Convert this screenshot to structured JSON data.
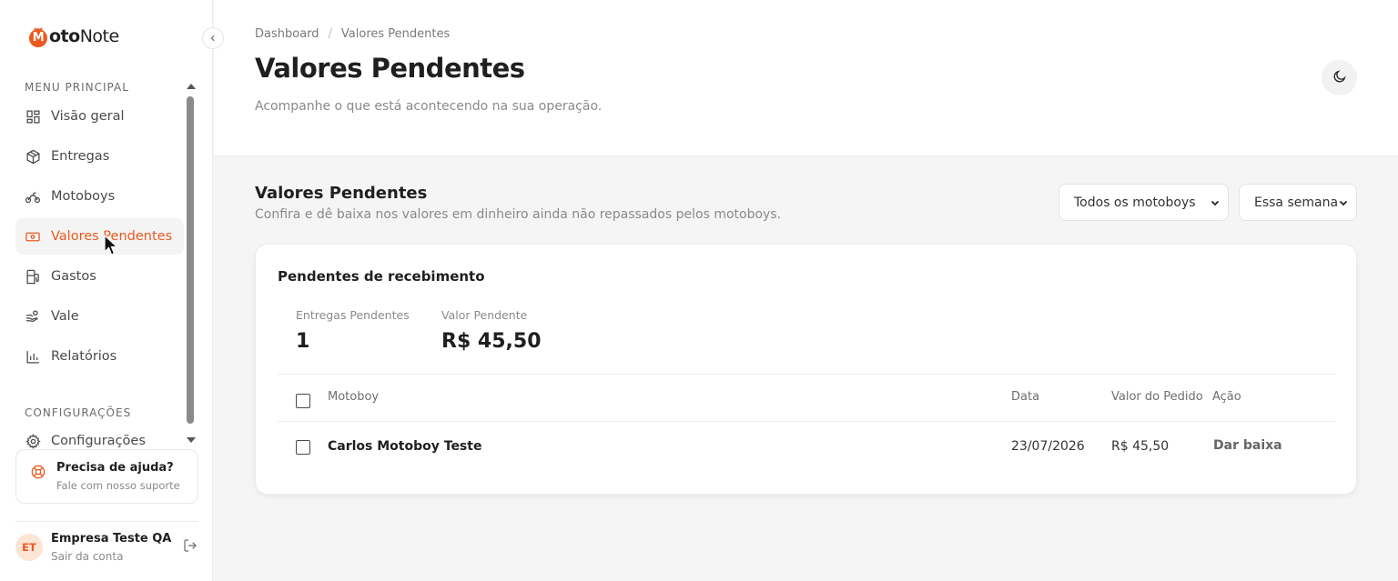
{
  "brand": {
    "logo_letter": "M",
    "logo_bold": "oto",
    "logo_rest": "Note"
  },
  "sidebar": {
    "menu_label": "MENU PRINCIPAL",
    "items": [
      {
        "label": "Visão geral",
        "icon": "dashboard-icon"
      },
      {
        "label": "Entregas",
        "icon": "package-icon"
      },
      {
        "label": "Motoboys",
        "icon": "bike-icon"
      },
      {
        "label": "Valores Pendentes",
        "icon": "banknote-icon",
        "active": true
      },
      {
        "label": "Gastos",
        "icon": "fuel-icon"
      },
      {
        "label": "Vale",
        "icon": "hand-coins-icon"
      },
      {
        "label": "Relatórios",
        "icon": "bar-chart-icon"
      }
    ],
    "config_label": "CONFIGURAÇÕES",
    "config_items": [
      {
        "label": "Configurações",
        "icon": "gear-icon"
      }
    ],
    "help": {
      "title": "Precisa de ajuda?",
      "subtitle": "Fale com nosso suporte"
    },
    "user": {
      "initials": "ET",
      "name": "Empresa Teste QA",
      "action": "Sair da conta"
    }
  },
  "header": {
    "breadcrumb": [
      "Dashboard",
      "Valores Pendentes"
    ],
    "breadcrumb_sep": "/",
    "title": "Valores Pendentes",
    "subtitle": "Acompanhe o que está acontecendo na sua operação."
  },
  "section": {
    "title": "Valores Pendentes",
    "subtitle": "Confira e dê baixa nos valores em dinheiro ainda não repassados pelos motoboys.",
    "filters": {
      "motoboy": "Todos os motoboys",
      "period": "Essa semana"
    }
  },
  "card": {
    "title": "Pendentes de recebimento",
    "stats": [
      {
        "label": "Entregas Pendentes",
        "value": "1"
      },
      {
        "label": "Valor Pendente",
        "value": "R$ 45,50"
      }
    ],
    "columns": [
      "Motoboy",
      "Data",
      "Valor do Pedido",
      "Ação"
    ],
    "rows": [
      {
        "motoboy": "Carlos Motoboy Teste",
        "date": "23/07/2026",
        "value": "R$ 45,50",
        "action": "Dar baixa"
      }
    ]
  },
  "colors": {
    "accent": "#ea5a1f",
    "active_bg": "#f4f4f4"
  }
}
